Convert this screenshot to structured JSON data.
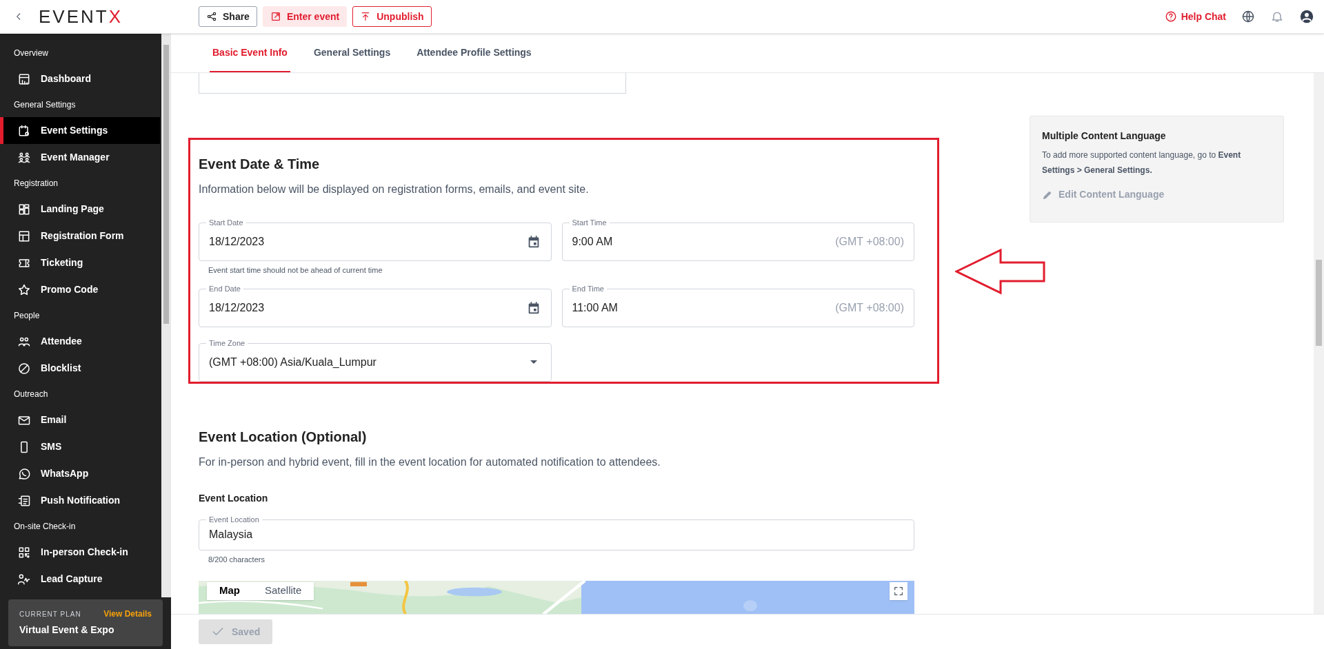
{
  "header": {
    "logo": {
      "text": "EVENT",
      "accent": "X"
    },
    "actions": [
      {
        "label": "Share",
        "kind": "outline"
      },
      {
        "label": "Enter event",
        "kind": "tint"
      },
      {
        "label": "Unpublish",
        "kind": "danger"
      }
    ],
    "help": "Help Chat"
  },
  "sidebar": {
    "sections": [
      {
        "title": "Overview",
        "items": [
          {
            "label": "Dashboard",
            "selected": false
          }
        ]
      },
      {
        "title": "General Settings",
        "items": [
          {
            "label": "Event Settings",
            "selected": true
          },
          {
            "label": "Event Manager",
            "selected": false
          }
        ]
      },
      {
        "title": "Registration",
        "items": [
          {
            "label": "Landing Page",
            "selected": false
          },
          {
            "label": "Registration Form",
            "selected": false
          },
          {
            "label": "Ticketing",
            "selected": false
          },
          {
            "label": "Promo Code",
            "selected": false
          }
        ]
      },
      {
        "title": "People",
        "items": [
          {
            "label": "Attendee",
            "selected": false
          },
          {
            "label": "Blocklist",
            "selected": false
          }
        ]
      },
      {
        "title": "Outreach",
        "items": [
          {
            "label": "Email",
            "selected": false
          },
          {
            "label": "SMS",
            "selected": false
          },
          {
            "label": "WhatsApp",
            "selected": false
          },
          {
            "label": "Push Notification",
            "selected": false
          }
        ]
      },
      {
        "title": "On-site Check-in",
        "items": [
          {
            "label": "In-person Check-in",
            "selected": false
          },
          {
            "label": "Lead Capture",
            "selected": false
          }
        ]
      }
    ],
    "plan": {
      "label": "CURRENT PLAN",
      "link": "View Details",
      "name": "Virtual Event & Expo"
    }
  },
  "tabs": [
    {
      "label": "Basic Event Info",
      "selected": true
    },
    {
      "label": "General Settings",
      "selected": false
    },
    {
      "label": "Attendee Profile Settings",
      "selected": false
    }
  ],
  "date_time": {
    "title": "Event Date & Time",
    "description": "Information below will be displayed on registration forms, emails, and event site.",
    "start_date": {
      "label": "Start Date",
      "value": "18/12/2023",
      "helper": "Event start time should not be ahead of current time"
    },
    "start_time": {
      "label": "Start Time",
      "value": "9:00 AM",
      "zone": "(GMT +08:00)"
    },
    "end_date": {
      "label": "End Date",
      "value": "18/12/2023"
    },
    "end_time": {
      "label": "End Time",
      "value": "11:00 AM",
      "zone": "(GMT +08:00)"
    },
    "time_zone": {
      "label": "Time Zone",
      "value": "(GMT +08:00) Asia/Kuala_Lumpur"
    }
  },
  "location": {
    "title": "Event Location (Optional)",
    "description": "For in-person and hybrid event, fill in the event location for automated notification to attendees.",
    "subtitle": "Event Location",
    "field": {
      "label": "Event Location",
      "value": "Malaysia",
      "helper": "8/200 characters"
    },
    "map_types": [
      {
        "label": "Map",
        "selected": true
      },
      {
        "label": "Satellite",
        "selected": false
      }
    ]
  },
  "language_panel": {
    "title": "Multiple Content Language",
    "text": "To add more supported content language, go to **Event Settings > General Settings.**",
    "action": {
      "label": "Edit Content Language",
      "disabled": true
    }
  },
  "footer": {
    "button": {
      "label": "Saved",
      "disabled": true
    }
  }
}
